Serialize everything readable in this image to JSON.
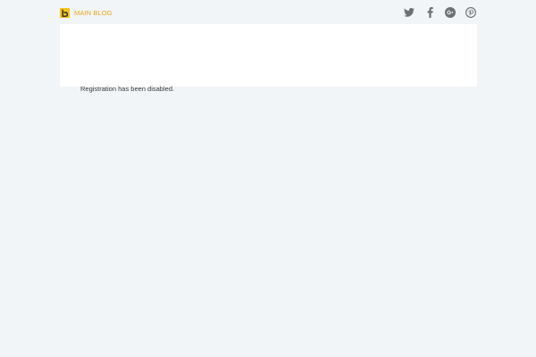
{
  "header": {
    "brand_label": "MAIN BLOG",
    "brand_color": "#e8a514",
    "logo_color": "#f6c21c",
    "logo_icon": "b-logo-icon"
  },
  "social": {
    "icon_color": "#6d6f72",
    "items": [
      {
        "icon": "twitter-icon"
      },
      {
        "icon": "facebook-icon"
      },
      {
        "icon": "google-plus-icon"
      },
      {
        "icon": "pinterest-icon"
      }
    ]
  },
  "content": {
    "message": "Registration has been disabled."
  },
  "colors": {
    "background": "#f1f5f8",
    "card": "#ffffff",
    "text": "#3a3a3a"
  }
}
